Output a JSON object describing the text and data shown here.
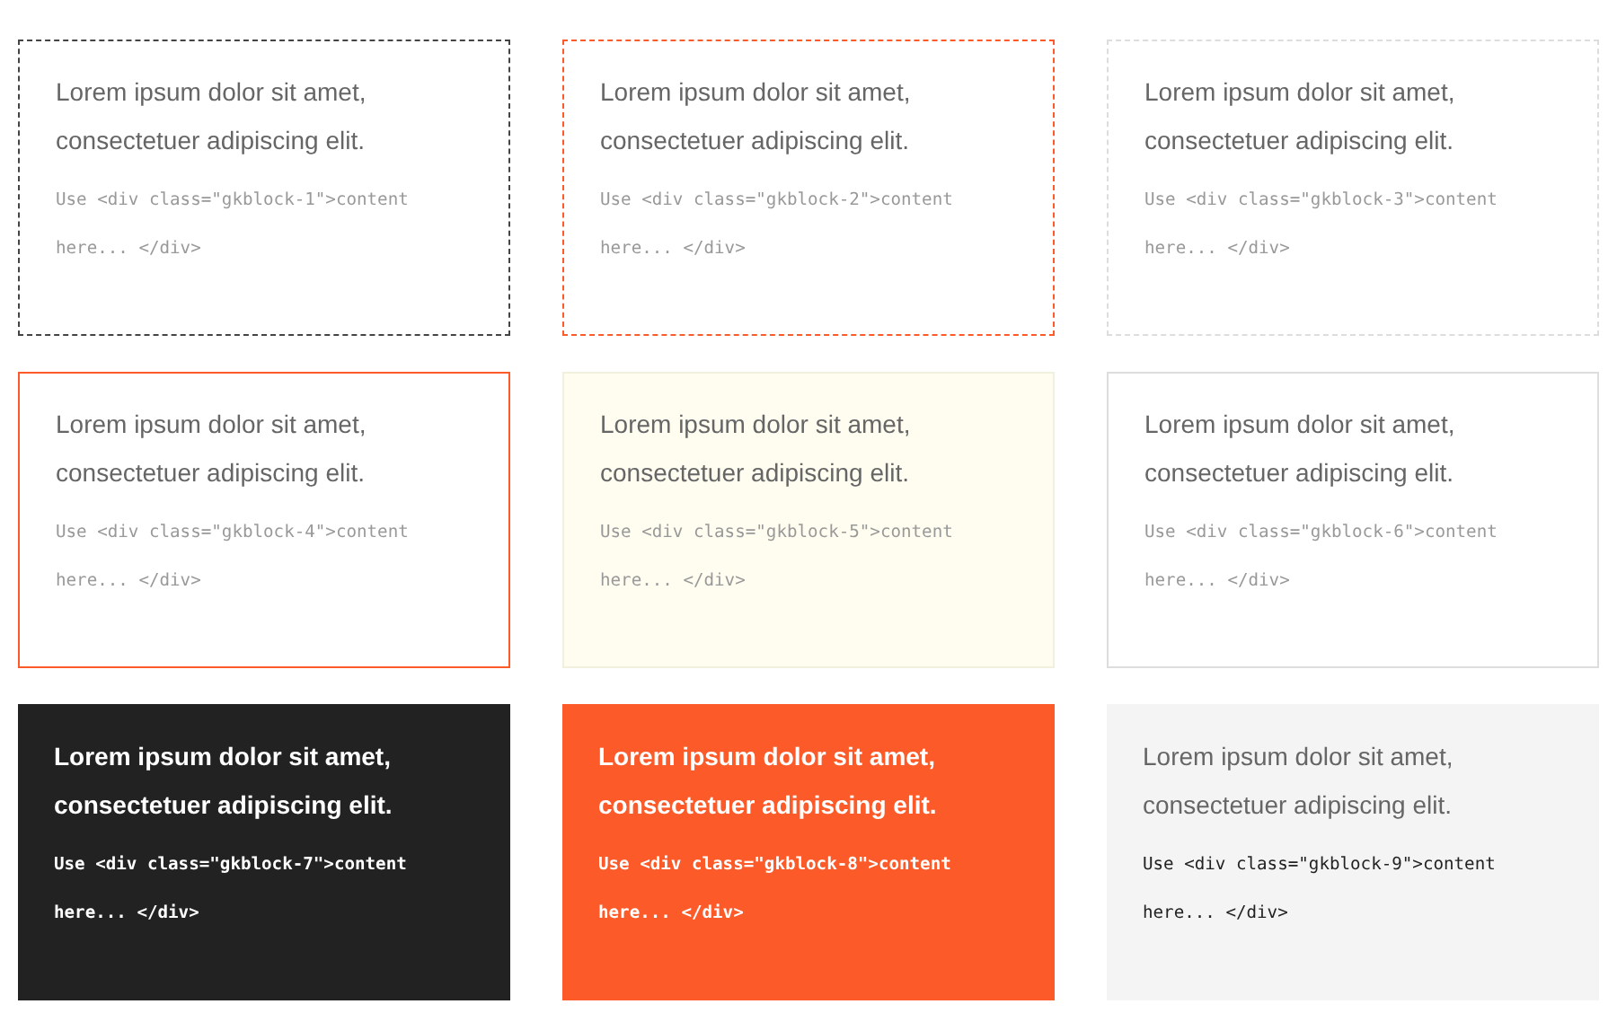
{
  "blocks": [
    {
      "kind": "dashed-dark",
      "text": "Lorem ipsum dolor sit amet, consectetuer adipiscing elit.",
      "code": "Use <div class=\"gkblock-1\">content here... </div>"
    },
    {
      "kind": "dashed-orange",
      "text": "Lorem ipsum dolor sit amet, consectetuer adipiscing elit.",
      "code": "Use <div class=\"gkblock-2\">content here... </div>"
    },
    {
      "kind": "dashed-light",
      "text": "Lorem ipsum dolor sit amet, consectetuer adipiscing elit.",
      "code": "Use <div class=\"gkblock-3\">content here... </div>"
    },
    {
      "kind": "solid-orange",
      "text": "Lorem ipsum dolor sit amet, consectetuer adipiscing elit.",
      "code": "Use <div class=\"gkblock-4\">content here... </div>"
    },
    {
      "kind": "cream",
      "text": "Lorem ipsum dolor sit amet, consectetuer adipiscing elit.",
      "code": "Use <div class=\"gkblock-5\">content here... </div>"
    },
    {
      "kind": "solid-light",
      "text": "Lorem ipsum dolor sit amet, consectetuer adipiscing elit.",
      "code": "Use <div class=\"gkblock-6\">content here... </div>"
    },
    {
      "kind": "dark",
      "text": "Lorem ipsum dolor sit amet, consectetuer adipiscing elit.",
      "code": "Use <div class=\"gkblock-7\">content here... </div>"
    },
    {
      "kind": "orange",
      "text": "Lorem ipsum dolor sit amet, consectetuer adipiscing elit.",
      "code": "Use <div class=\"gkblock-8\">content here... </div>"
    },
    {
      "kind": "grey",
      "text": "Lorem ipsum dolor sit amet, consectetuer adipiscing elit.",
      "code": "Use <div class=\"gkblock-9\">content here... </div>"
    }
  ]
}
